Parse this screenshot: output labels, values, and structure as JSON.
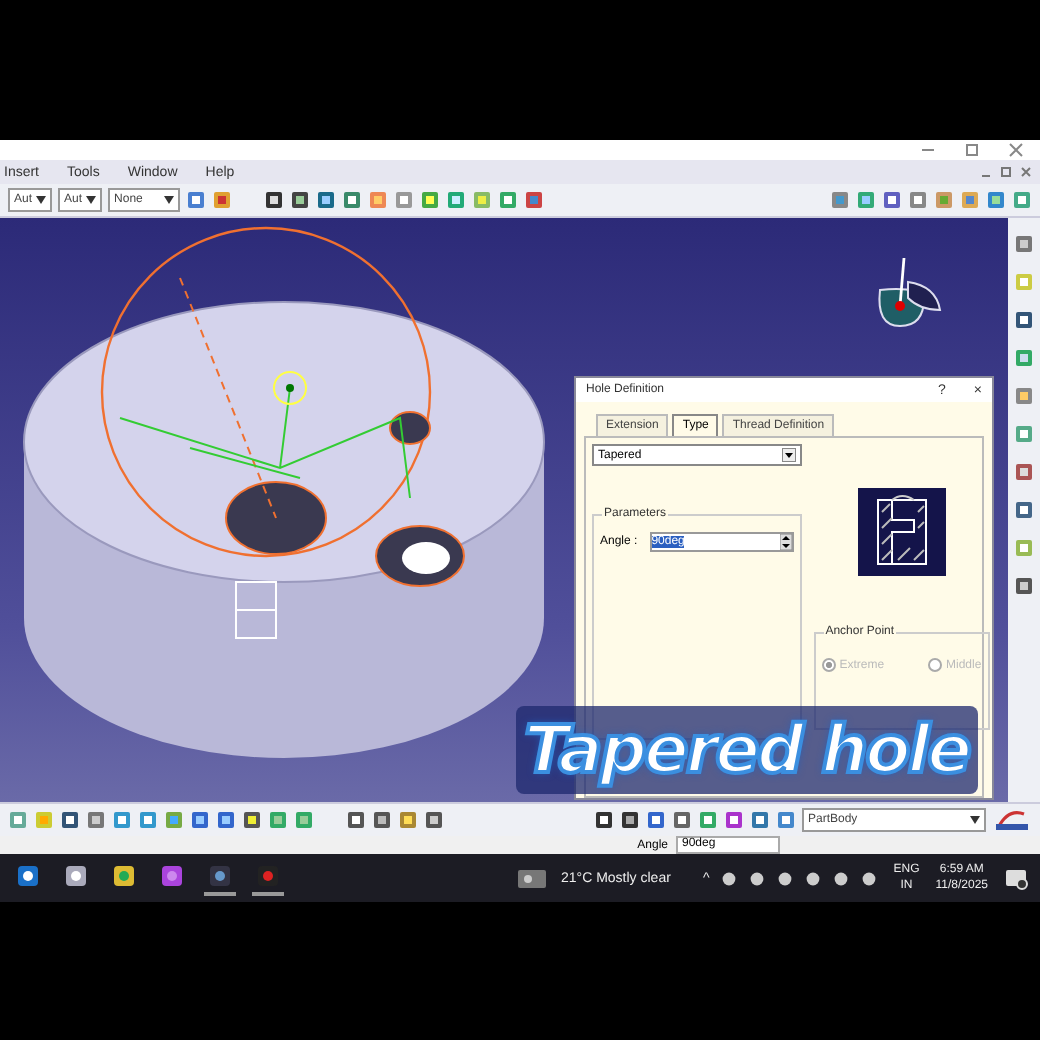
{
  "menu": [
    "Insert",
    "Tools",
    "Window",
    "Help"
  ],
  "toolbar": {
    "dropdowns": [
      "Aut",
      "Aut",
      "None"
    ]
  },
  "dialog": {
    "title": "Hole Definition",
    "help": "?",
    "close": "×",
    "tabs": [
      {
        "label": "Extension",
        "selected": false
      },
      {
        "label": "Type",
        "selected": true
      },
      {
        "label": "Thread Definition",
        "selected": false
      }
    ],
    "type_value": "Tapered",
    "parameters": {
      "title": "Parameters",
      "angle_label": "Angle :",
      "angle_value": "90deg"
    },
    "anchor_point": {
      "title": "Anchor Point",
      "disabled": true,
      "options": [
        {
          "label": "Extreme",
          "selected": true
        },
        {
          "label": "Middle",
          "selected": false
        }
      ]
    }
  },
  "bottom_toolbar": {
    "body": "PartBody"
  },
  "status": {
    "label": "Angle",
    "value": "90deg"
  },
  "taskbar": {
    "weather": "21°C Mostly clear",
    "chevron": "^",
    "language": [
      "ENG",
      "IN"
    ],
    "time": "6:59 AM",
    "date": "11/8/2025"
  },
  "caption": "Tapered hole"
}
